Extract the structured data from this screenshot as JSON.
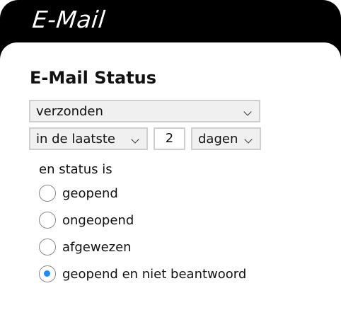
{
  "header": {
    "title": "E-Mail"
  },
  "section": {
    "title": "E-Mail Status"
  },
  "filters": {
    "status_select": "verzonden",
    "range_select": "in de laatste",
    "count_value": "2",
    "unit_select": "dagen"
  },
  "status": {
    "label": "en status is",
    "options": [
      {
        "label": "geopend",
        "checked": false
      },
      {
        "label": "ongeopend",
        "checked": false
      },
      {
        "label": "afgewezen",
        "checked": false
      },
      {
        "label": "geopend en niet beantwoord",
        "checked": true
      }
    ]
  },
  "colors": {
    "accent": "#1a8cff",
    "header_bg": "#000000"
  }
}
